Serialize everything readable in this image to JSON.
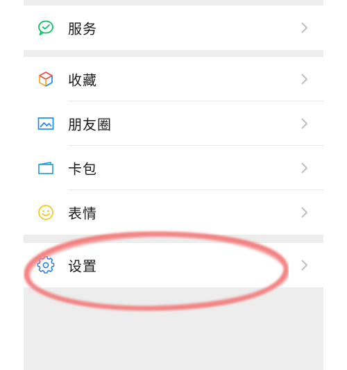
{
  "menu": {
    "services": {
      "label": "服务",
      "icon": "wechat-pay-icon"
    },
    "favorites": {
      "label": "收藏",
      "icon": "cube-icon"
    },
    "moments": {
      "label": "朋友圈",
      "icon": "image-icon"
    },
    "cards": {
      "label": "卡包",
      "icon": "card-icon"
    },
    "stickers": {
      "label": "表情",
      "icon": "smile-icon"
    },
    "settings": {
      "label": "设置",
      "icon": "gear-icon"
    }
  },
  "colors": {
    "services_icon": "#07c160",
    "moments_icon": "#1989fa",
    "cards_icon": "#2a9fd6",
    "stickers_icon": "#f5c518",
    "settings_icon": "#2f7fd8",
    "highlight_ring": "#f26a6a"
  }
}
